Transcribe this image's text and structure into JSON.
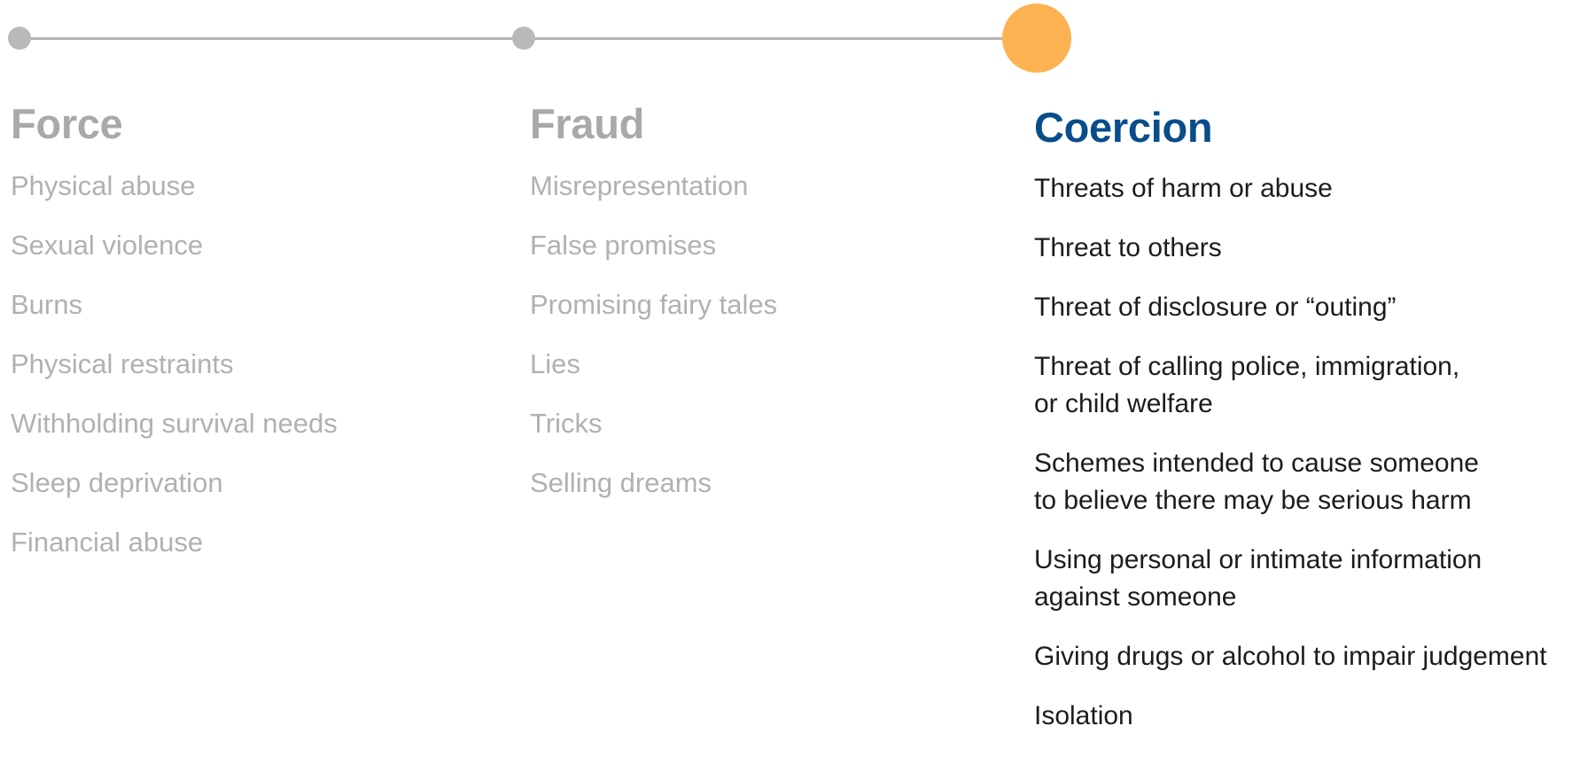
{
  "progress": {
    "steps": [
      {
        "name": "Force",
        "state": "inactive"
      },
      {
        "name": "Fraud",
        "state": "inactive"
      },
      {
        "name": "Coercion",
        "state": "active"
      }
    ],
    "active_step": 3,
    "colors": {
      "inactive_dot": "#b9b9b9",
      "active_dot": "#fdb251",
      "line": "#b3b3b3"
    }
  },
  "columns": {
    "force": {
      "title": "Force",
      "items": [
        "Physical abuse",
        "Sexual violence",
        "Burns",
        "Physical restraints",
        "Withholding survival needs",
        "Sleep deprivation",
        "Financial abuse"
      ]
    },
    "fraud": {
      "title": "Fraud",
      "items": [
        "Misrepresentation",
        "False promises",
        "Promising fairy tales",
        "Lies",
        "Tricks",
        "Selling dreams"
      ]
    },
    "coercion": {
      "title": "Coercion",
      "items": [
        "Threats of harm or abuse",
        "Threat to others",
        "Threat of disclosure or “outing”",
        "Threat of calling police, immigration,\nor child welfare",
        "Schemes intended to cause someone\nto believe there may be serious harm",
        "Using personal or intimate information\nagainst someone",
        "Giving drugs or alcohol to impair judgement",
        "Isolation"
      ]
    }
  },
  "colors": {
    "active_title": "#094d8a",
    "inactive_title": "#a9a9a9",
    "inactive_text": "#b1b1b1",
    "active_text": "#1c1c1c"
  }
}
